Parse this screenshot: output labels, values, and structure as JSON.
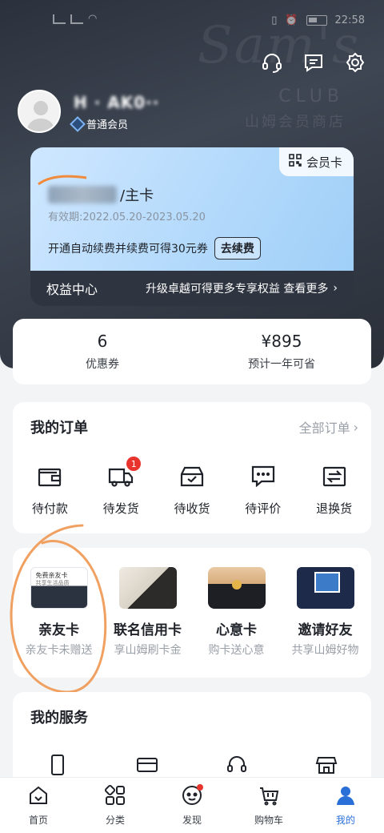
{
  "status_bar": {
    "time": "22:58"
  },
  "header": {
    "icons": [
      "headset-icon",
      "message-icon",
      "settings-icon"
    ],
    "username": "H   ·  AK0··",
    "member_level": "普通会员",
    "watermark": "Sam's",
    "watermark_club": "CLUB",
    "watermark_cn": "山姆会员商店"
  },
  "vip_card": {
    "member_card_label": "会员卡",
    "card_type_suffix": "/主卡",
    "validity": "有效期:2022.05.20-2023.05.20",
    "renew_text": "开通自动续费并续费可得30元券",
    "renew_button": "去续费",
    "rights_title": "权益中心",
    "rights_promo": "升级卓越可得更多专享权益 查看更多"
  },
  "stats": [
    {
      "value": "6",
      "label": "优惠券"
    },
    {
      "value": "¥895",
      "label": "预计一年可省"
    }
  ],
  "orders": {
    "title": "我的订单",
    "all_label": "全部订单",
    "items": [
      {
        "label": "待付款",
        "icon": "wallet-icon"
      },
      {
        "label": "待发货",
        "icon": "truck-icon",
        "badge": "1"
      },
      {
        "label": "待收货",
        "icon": "inbox-icon"
      },
      {
        "label": "待评价",
        "icon": "comment-icon"
      },
      {
        "label": "退换货",
        "icon": "exchange-icon"
      }
    ]
  },
  "promos": [
    {
      "title": "亲友卡",
      "subtitle": "亲友卡未赠送",
      "img_text": "免费亲友卡",
      "img_sub": "共享生活品质"
    },
    {
      "title": "联名信用卡",
      "subtitle": "享山姆刷卡金"
    },
    {
      "title": "心意卡",
      "subtitle": "购卡送心意"
    },
    {
      "title": "邀请好友",
      "subtitle": "共享山姆好物"
    }
  ],
  "services": {
    "title": "我的服务",
    "icons": [
      "phone-icon",
      "card-icon",
      "headset-icon",
      "storefront-icon"
    ]
  },
  "tabbar": [
    {
      "label": "首页",
      "icon": "home-icon"
    },
    {
      "label": "分类",
      "icon": "category-icon"
    },
    {
      "label": "发现",
      "icon": "discover-icon",
      "dot": true
    },
    {
      "label": "购物车",
      "icon": "cart-icon"
    },
    {
      "label": "我的",
      "icon": "profile-icon",
      "active": true
    }
  ],
  "colors": {
    "accent": "#2a6fd8",
    "badge": "#e8342c",
    "annotation": "#f0a060"
  }
}
